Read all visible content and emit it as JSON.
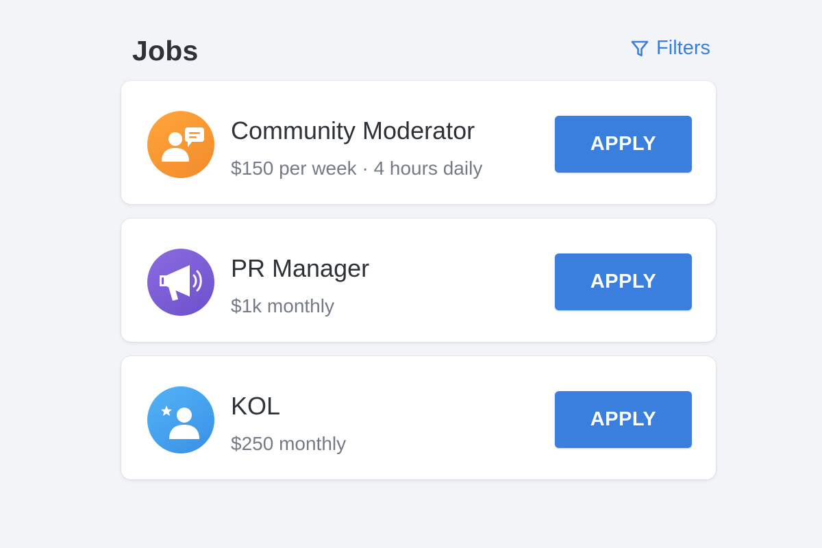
{
  "header": {
    "title": "Jobs",
    "filters_label": "Filters",
    "filters_icon": "filter-icon"
  },
  "jobs": [
    {
      "title": "Community Moderator",
      "meta": "$150 per week · 4 hours daily",
      "icon": "community-moderator-icon",
      "icon_color": "#f7962f",
      "apply_label": "APPLY"
    },
    {
      "title": "PR Manager",
      "meta": "$1k monthly",
      "icon": "megaphone-icon",
      "icon_color": "#7a5bd6",
      "apply_label": "APPLY"
    },
    {
      "title": "KOL",
      "meta": "$250 monthly",
      "icon": "influencer-icon",
      "icon_color": "#439fef",
      "apply_label": "APPLY"
    }
  ],
  "colors": {
    "accent": "#3a7fde",
    "background": "#f2f4f8",
    "card": "#ffffff",
    "title_text": "#2d3138",
    "meta_text": "#747b86"
  }
}
